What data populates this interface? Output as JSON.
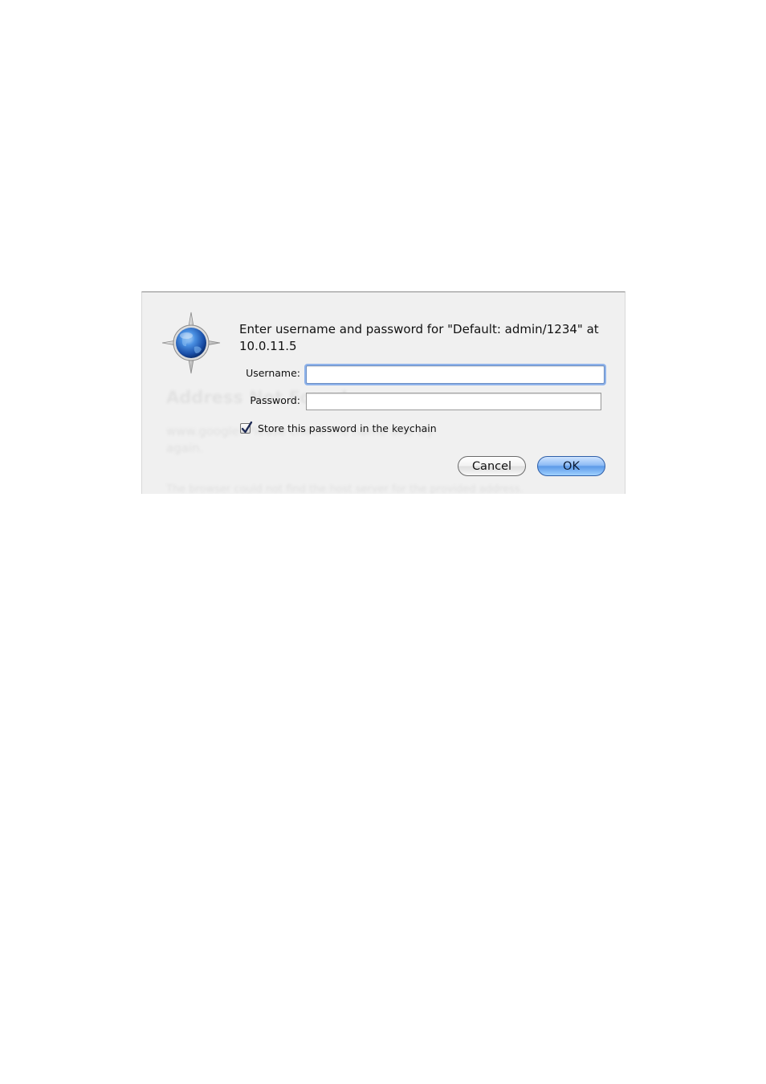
{
  "dialog": {
    "prompt": "Enter username and password for \"Default: admin/1234\" at 10.0.11.5",
    "username_label": "Username:",
    "username_value": "",
    "password_label": "Password:",
    "password_value": "",
    "store_password_label": "Store this password in the keychain",
    "store_password_checked": true,
    "cancel_label": "Cancel",
    "ok_label": "OK",
    "icon": "safari-compass-icon"
  },
  "background_page": {
    "heading": "Address Not Found",
    "line1": "www.google.                                 Please check the name and try",
    "line2": "again.",
    "line3": "The browser could not find the host server for the provided address."
  },
  "colors": {
    "focus_ring": "#8fb3ea",
    "ok_button": "#5d9ae8",
    "sheet_background": "#f0f0f0"
  }
}
